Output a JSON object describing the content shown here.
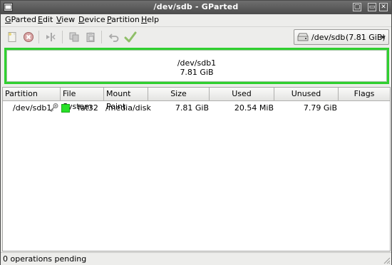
{
  "window": {
    "title": "/dev/sdb - GParted"
  },
  "menu": [
    {
      "pre": "",
      "ul": "G",
      "post": "Parted"
    },
    {
      "pre": "",
      "ul": "E",
      "post": "dit"
    },
    {
      "pre": "",
      "ul": "V",
      "post": "iew"
    },
    {
      "pre": "",
      "ul": "D",
      "post": "evice"
    },
    {
      "pre": "",
      "ul": "P",
      "post": "artition"
    },
    {
      "pre": "",
      "ul": "H",
      "post": "elp"
    }
  ],
  "toolbar": {
    "icons": [
      "new-partition-icon",
      "delete-partition-icon",
      "resize-move-icon",
      "copy-icon",
      "paste-icon",
      "undo-icon",
      "apply-icon"
    ]
  },
  "device": {
    "name": "/dev/sdb",
    "size": "(7.81 GiB)"
  },
  "map": {
    "partition": "/dev/sdb1",
    "size": "7.81 GiB",
    "color": "#2fd02f"
  },
  "table": {
    "headers": [
      "Partition",
      "File System",
      "Mount Point",
      "Size",
      "Used",
      "Unused",
      "Flags"
    ],
    "rows": [
      {
        "partition": "/dev/sdb1",
        "filesystem": "fat32",
        "fs_color": "#28e028",
        "mount_point": "/media/disk",
        "size": "7.81 GiB",
        "used": "20.54 MiB",
        "unused": "7.79 GiB",
        "flags": ""
      }
    ]
  },
  "status": {
    "text": "0 operations pending"
  }
}
